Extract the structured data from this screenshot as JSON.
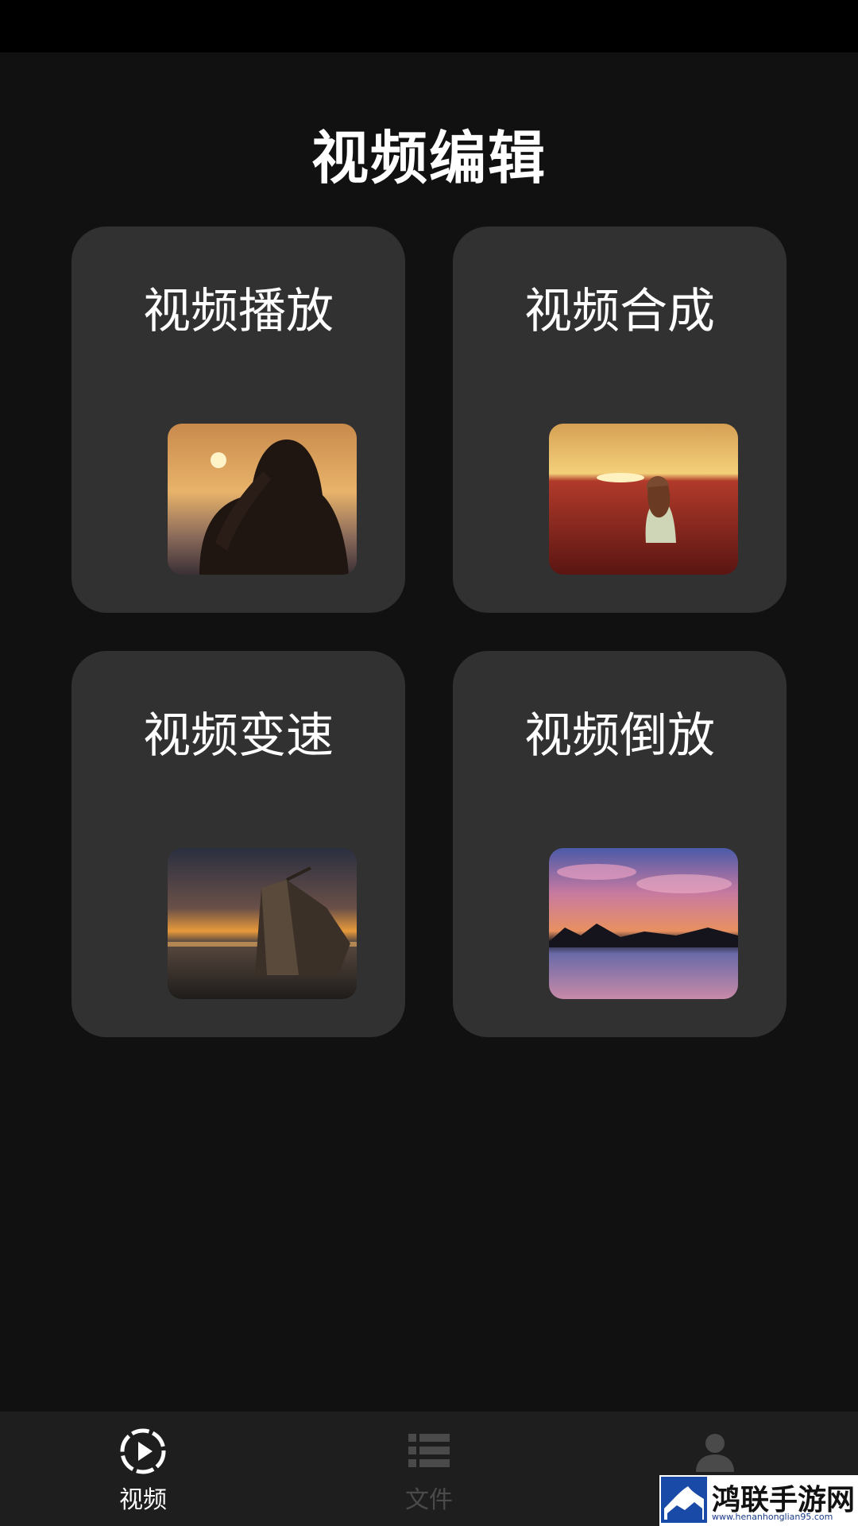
{
  "header": {
    "title": "视频编辑"
  },
  "cards": [
    {
      "label": "视频播放",
      "thumb": "woman-sunset-photo"
    },
    {
      "label": "视频合成",
      "thumb": "girl-flower-field-photo"
    },
    {
      "label": "视频变速",
      "thumb": "shipwreck-sunset-photo"
    },
    {
      "label": "视频倒放",
      "thumb": "lake-clouds-photo"
    }
  ],
  "tabbar": {
    "tabs": [
      {
        "label": "视频",
        "icon": "play-circle-icon",
        "active": true
      },
      {
        "label": "文件",
        "icon": "list-icon",
        "active": false
      },
      {
        "label": "",
        "icon": "person-icon",
        "active": false
      }
    ]
  },
  "watermark": {
    "name": "鸿联手游网",
    "url": "www.henanhonglian95.com"
  },
  "colors": {
    "background": "#111111",
    "card": "#313131",
    "tabbar": "#1e1e1e",
    "active_tab": "#ffffff",
    "inactive_tab": "#4a4a4a"
  }
}
